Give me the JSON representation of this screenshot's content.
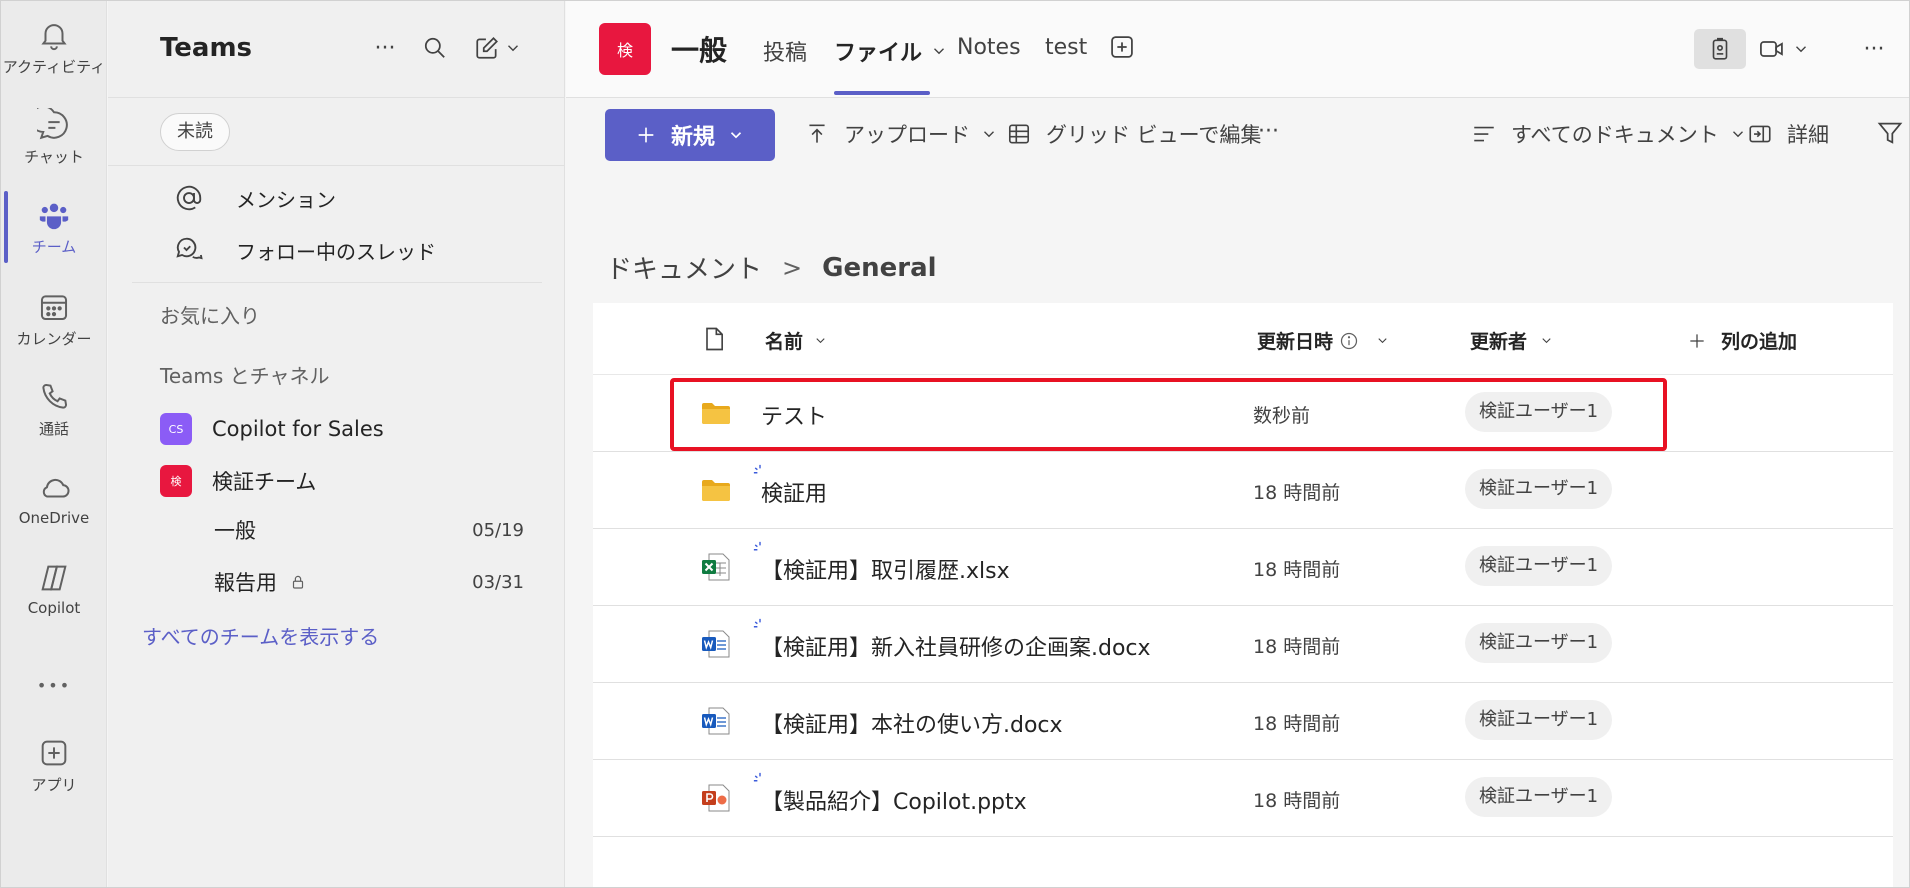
{
  "rail": {
    "items": [
      {
        "label": "アクティビティ",
        "icon": "bell-icon"
      },
      {
        "label": "チャット",
        "icon": "chat-icon"
      },
      {
        "label": "チーム",
        "icon": "teams-icon"
      },
      {
        "label": "カレンダー",
        "icon": "calendar-icon"
      },
      {
        "label": "通話",
        "icon": "phone-icon"
      },
      {
        "label": "OneDrive",
        "icon": "cloud-icon"
      },
      {
        "label": "Copilot",
        "icon": "copilot-icon"
      },
      {
        "label": "アプリ",
        "icon": "add-app-icon"
      }
    ],
    "more": "•••"
  },
  "panel": {
    "title": "Teams",
    "more": "···",
    "filter_chip": "未読",
    "mentions": "メンション",
    "followed_threads": "フォロー中のスレッド",
    "favorites": "お気に入り",
    "teams_and_channels": "Teams とチャネル",
    "teams": [
      {
        "name": "Copilot for Sales",
        "avatar": "CS",
        "color": "#8b5cf6"
      },
      {
        "name": "検証チーム",
        "avatar": "検",
        "color": "#e8173f"
      }
    ],
    "channels": [
      {
        "name": "一般",
        "date": "05/19"
      },
      {
        "name": "報告用",
        "date": "03/31"
      }
    ],
    "show_all": "すべてのチームを表示する"
  },
  "topbar": {
    "avatar": "検",
    "channel_title": "一般",
    "tabs": {
      "posts": "投稿",
      "files": "ファイル",
      "notes": "Notes",
      "test": "test"
    },
    "more": "···"
  },
  "toolbar": {
    "new_label": "新規",
    "upload_label": "アップロード",
    "grid_edit_label": "グリッド ビューで編集",
    "more": "···",
    "view_label": "すべてのドキュメント",
    "details_label": "詳細"
  },
  "breadcrumb": {
    "root": "ドキュメント",
    "sep": ">",
    "current": "General"
  },
  "table": {
    "headers": {
      "name": "名前",
      "modified": "更新日時",
      "modified_by": "更新者",
      "add_column": "列の追加"
    },
    "rows": [
      {
        "name": "テスト",
        "type": "folder",
        "date": "数秒前",
        "user": "検証ユーザー1",
        "new": false
      },
      {
        "name": "検証用",
        "type": "folder",
        "date": "18 時間前",
        "user": "検証ユーザー1",
        "new": true
      },
      {
        "name": "【検証用】取引履歴.xlsx",
        "type": "excel",
        "date": "18 時間前",
        "user": "検証ユーザー1",
        "new": true
      },
      {
        "name": "【検証用】新入社員研修の企画案.docx",
        "type": "word",
        "date": "18 時間前",
        "user": "検証ユーザー1",
        "new": true
      },
      {
        "name": "【検証用】本社の使い方.docx",
        "type": "word",
        "date": "18 時間前",
        "user": "検証ユーザー1",
        "new": false
      },
      {
        "name": "【製品紹介】Copilot.pptx",
        "type": "powerpoint",
        "date": "18 時間前",
        "user": "検証ユーザー1",
        "new": true
      }
    ]
  },
  "colors": {
    "accent": "#5b5fc7",
    "highlight": "#e81123",
    "folder": "#f5c342",
    "excel": "#107c41",
    "word": "#185abd",
    "powerpoint": "#c43e1c"
  }
}
